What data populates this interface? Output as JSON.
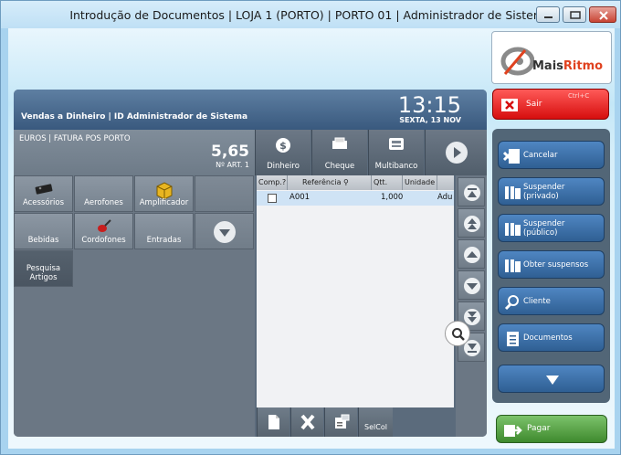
{
  "window": {
    "title": "Introdução de Documentos | LOJA 1 (PORTO) | PORTO 01 | Administrador de Sistema"
  },
  "header": {
    "title": "Vendas a Dinheiro | ID Administrador de Sistema",
    "time": "13:15",
    "date": "SEXTA, 13 NOV"
  },
  "totals": {
    "label": "EUROS | FATURA POS PORTO",
    "amount": "5,65",
    "count": "Nº ART. 1"
  },
  "payment_methods": [
    "Dinheiro",
    "Cheque",
    "Multibanco"
  ],
  "categories": [
    {
      "label": "Acessórios",
      "icon": "accessory-device-icon"
    },
    {
      "label": "Aerofones",
      "icon": ""
    },
    {
      "label": "Amplificador",
      "icon": "box-icon"
    },
    {
      "label": "Bebidas",
      "icon": ""
    },
    {
      "label": "Cordofones",
      "icon": "guitar-icon"
    },
    {
      "label": "Entradas",
      "icon": ""
    }
  ],
  "search_articles": {
    "line1": "Pesquisa",
    "line2": "Artigos"
  },
  "grid": {
    "columns": [
      "Comp.?",
      "Referência",
      "Qtt.",
      "Unidade"
    ],
    "rows": [
      {
        "checked": false,
        "reference": "A001",
        "quantity": "1,000",
        "unit": "Adu"
      }
    ]
  },
  "bottom_toolbar": {
    "selcol_label": "SelCol"
  },
  "logo": {
    "brand_prefix": "Mais",
    "brand_suffix": "Ritmo"
  },
  "exit": {
    "label": "Sair",
    "user": "Ctrl+C"
  },
  "side_actions": [
    {
      "label": "Cancelar",
      "icon": "cancel-doc-icon"
    },
    {
      "label": "Suspender (privado)",
      "icon": "suspend-icon"
    },
    {
      "label": "Suspender (público)",
      "icon": "suspend-icon"
    },
    {
      "label": "Obter suspensos",
      "icon": "suspend-icon"
    },
    {
      "label": "Cliente",
      "icon": "customer-search-icon"
    },
    {
      "label": "Documentos",
      "icon": "documents-icon"
    }
  ],
  "pay": {
    "label": "Pagar"
  },
  "colors": {
    "header_blue": "#39597e",
    "exit_red": "#d60e0e",
    "action_blue": "#2f5f93",
    "pay_green": "#3f8a2e",
    "selected_row": "#cfe3f5"
  }
}
